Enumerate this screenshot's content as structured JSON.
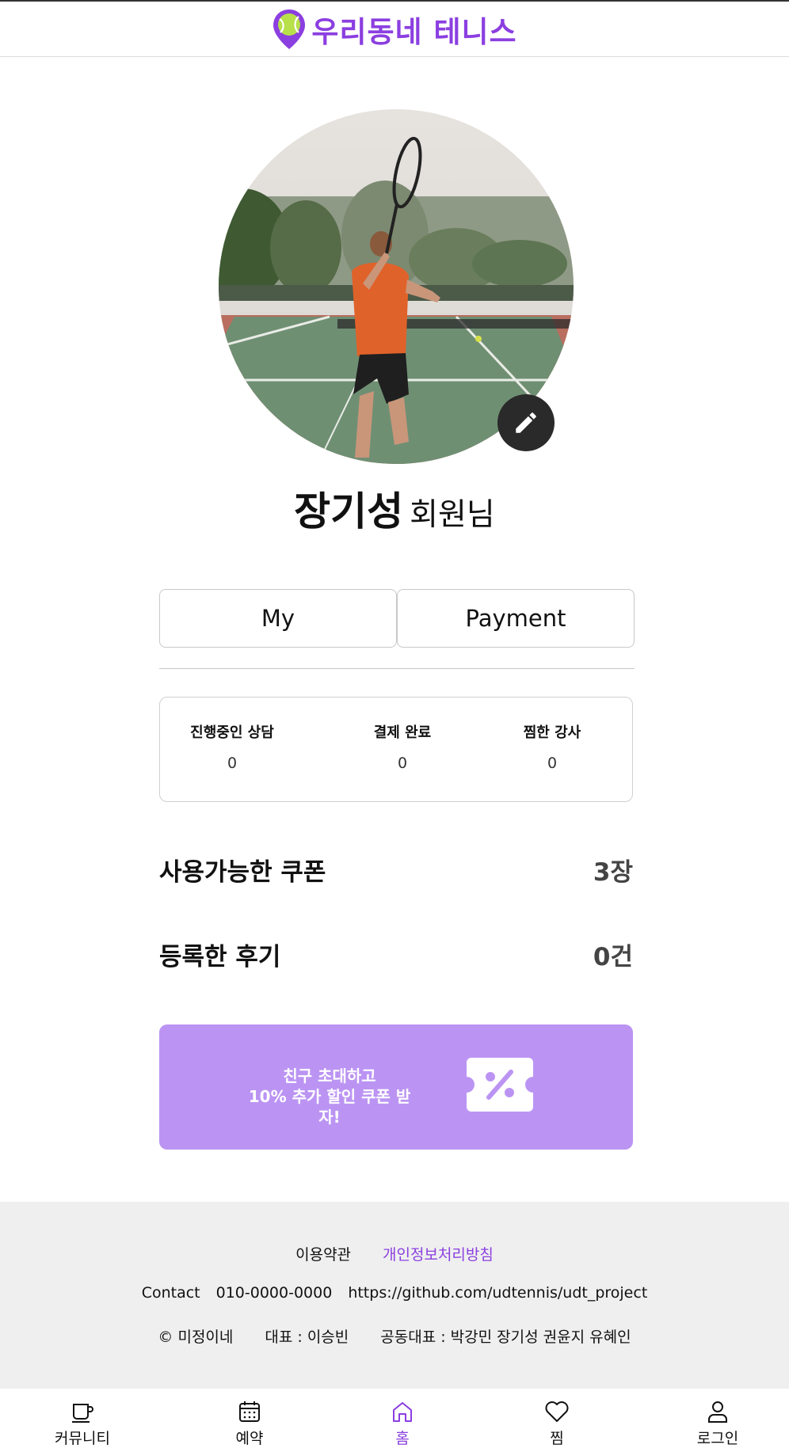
{
  "header": {
    "logo_text": "우리동네 테니스"
  },
  "profile": {
    "name": "장기성",
    "suffix": "회원님"
  },
  "tabs": [
    {
      "label": "My"
    },
    {
      "label": "Payment"
    }
  ],
  "stats": [
    {
      "label": "진행중인 상담",
      "value": "0"
    },
    {
      "label": "결제 완료",
      "value": "0"
    },
    {
      "label": "찜한 강사",
      "value": "0"
    }
  ],
  "coupons": {
    "label": "사용가능한 쿠폰",
    "value": "3장"
  },
  "reviews": {
    "label": "등록한 후기",
    "value": "0건"
  },
  "banner": {
    "line1": "친구 초대하고",
    "line2": "10% 추가 할인 쿠폰 받자!"
  },
  "footer": {
    "terms": "이용약관",
    "privacy": "개인정보처리방침",
    "contact_label": "Contact",
    "phone": "010-0000-0000",
    "github": "https://github.com/udtennis/udt_project",
    "copyright": "© 미정이네",
    "ceo": "대표 : 이승빈",
    "co_ceo": "공동대표 : 박강민 장기성 권윤지 유혜인"
  },
  "nav": [
    {
      "label": "커뮤니티",
      "icon": "cup-icon"
    },
    {
      "label": "예약",
      "icon": "calendar-icon"
    },
    {
      "label": "홈",
      "icon": "home-icon",
      "active": true
    },
    {
      "label": "찜",
      "icon": "heart-icon"
    },
    {
      "label": "로그인",
      "icon": "user-icon"
    }
  ],
  "colors": {
    "brand": "#8b3fe0",
    "banner": "#bb94f3",
    "footer_bg": "#efefef"
  }
}
